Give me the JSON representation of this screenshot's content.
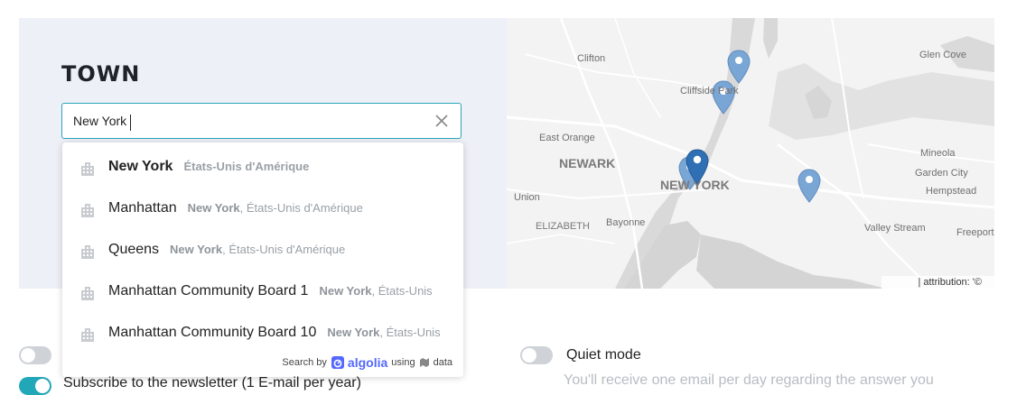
{
  "town": {
    "title": "TOWN",
    "search_value": "New York"
  },
  "suggestions": [
    {
      "name": "New York",
      "bold_meta": "",
      "meta": "États-Unis d'Amérique",
      "highlight": true
    },
    {
      "name": "Manhattan",
      "bold_meta": "New York",
      "meta": ", États-Unis d'Amérique",
      "highlight": false
    },
    {
      "name": "Queens",
      "bold_meta": "New York",
      "meta": ", États-Unis d'Amérique",
      "highlight": false
    },
    {
      "name": "Manhattan Community Board 1",
      "bold_meta": "New York",
      "meta": ", États-Unis",
      "highlight": false
    },
    {
      "name": "Manhattan Community Board 10",
      "bold_meta": "New York",
      "meta": ", États-Unis",
      "highlight": false
    }
  ],
  "footer": {
    "search_by": "Search by",
    "brand": "algolia",
    "using": "using",
    "data": "data"
  },
  "map": {
    "labels": {
      "clifton": "Clifton",
      "cliffside_park": "Cliffside Park",
      "glen_cove": "Glen Cove",
      "east_orange": "East Orange",
      "newark": "NEWARK",
      "new_york": "NEW YORK",
      "mineola": "Mineola",
      "garden_city": "Garden City",
      "hempstead": "Hempstead",
      "union": "Union",
      "elizabeth": "ELIZABETH",
      "bayonne": "Bayonne",
      "valley_stream": "Valley Stream",
      "freeport": "Freeport"
    },
    "attribution": "| attribution: '©",
    "pin_color": "#7aa6d6",
    "pin_active_color": "#2f6fb3"
  },
  "settings": {
    "quiet_mode_label": "Quiet mode",
    "quiet_mode_desc": "You'll receive one email per day regarding the answer you",
    "subscribe_label": "Subscribe to the newsletter (1 E-mail per year)"
  },
  "colors": {
    "accent": "#22a7b8",
    "panel_bg": "#eef0f7"
  }
}
